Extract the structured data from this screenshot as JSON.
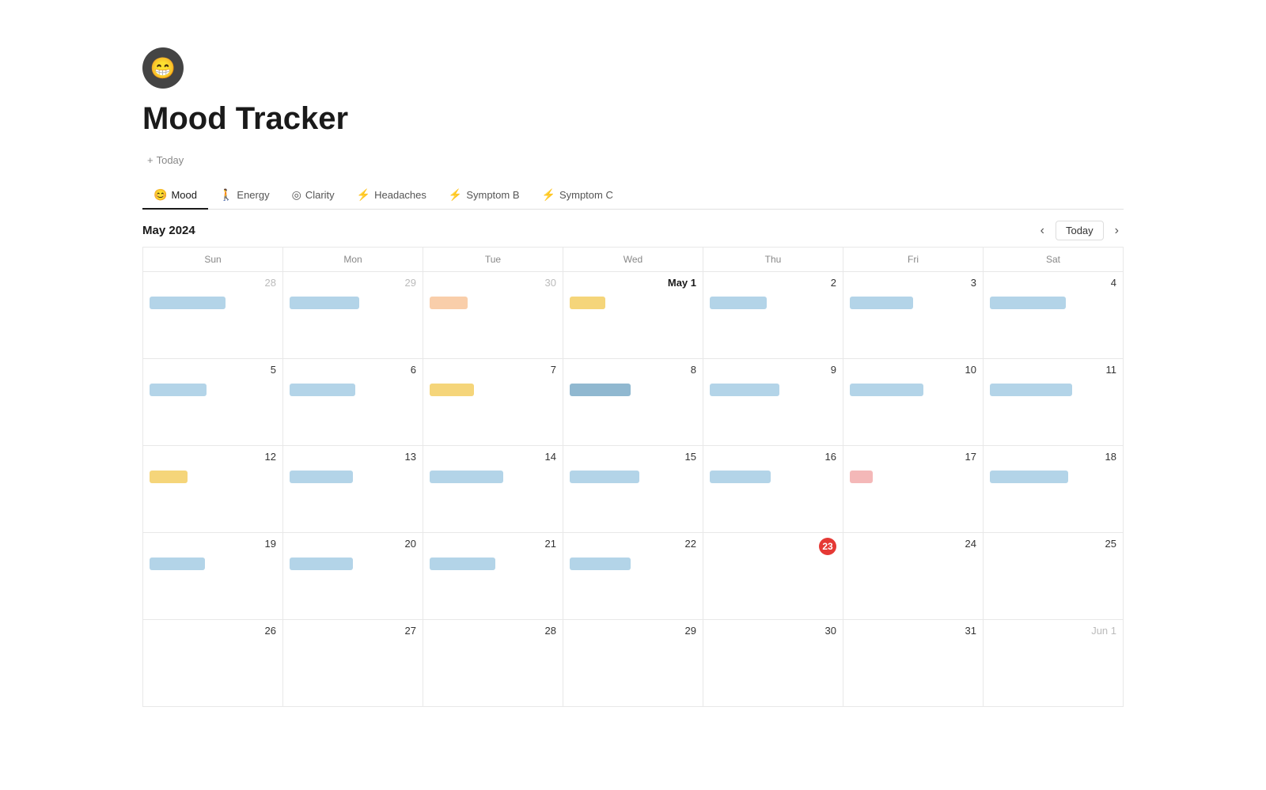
{
  "page": {
    "icon": "😁",
    "title": "Mood Tracker",
    "add_label": "+ Today"
  },
  "tabs": [
    {
      "id": "mood",
      "label": "Mood",
      "icon": "😊",
      "active": true
    },
    {
      "id": "energy",
      "label": "Energy",
      "icon": "🚶",
      "active": false
    },
    {
      "id": "clarity",
      "label": "Clarity",
      "icon": "◎",
      "active": false
    },
    {
      "id": "headaches",
      "label": "Headaches",
      "icon": "⚡",
      "active": false
    },
    {
      "id": "symptom-b",
      "label": "Symptom B",
      "icon": "⚡",
      "active": false
    },
    {
      "id": "symptom-c",
      "label": "Symptom C",
      "icon": "⚡",
      "active": false
    }
  ],
  "calendar": {
    "month_label": "May 2024",
    "today_btn": "Today",
    "days_of_week": [
      "Sun",
      "Mon",
      "Tue",
      "Wed",
      "Thu",
      "Fri",
      "Sat"
    ],
    "weeks": [
      {
        "days": [
          {
            "num": "28",
            "other_month": true,
            "bars": [
              {
                "color": "blue-light",
                "width": "60%"
              }
            ]
          },
          {
            "num": "29",
            "other_month": true,
            "bars": [
              {
                "color": "blue-light",
                "width": "55%"
              }
            ]
          },
          {
            "num": "30",
            "other_month": true,
            "bars": [
              {
                "color": "orange-light",
                "width": "30%"
              }
            ]
          },
          {
            "num": "May 1",
            "other_month": false,
            "bold": true,
            "bars": [
              {
                "color": "yellow-light",
                "width": "28%"
              }
            ]
          },
          {
            "num": "2",
            "other_month": false,
            "bars": [
              {
                "color": "blue-light",
                "width": "45%"
              }
            ]
          },
          {
            "num": "3",
            "other_month": false,
            "bars": [
              {
                "color": "blue-light",
                "width": "50%"
              }
            ]
          },
          {
            "num": "4",
            "other_month": false,
            "bars": [
              {
                "color": "blue-light",
                "width": "60%"
              }
            ]
          }
        ]
      },
      {
        "days": [
          {
            "num": "5",
            "other_month": false,
            "bars": [
              {
                "color": "blue-light",
                "width": "45%"
              }
            ]
          },
          {
            "num": "6",
            "other_month": false,
            "bars": [
              {
                "color": "blue-light",
                "width": "52%"
              }
            ]
          },
          {
            "num": "7",
            "other_month": false,
            "bars": [
              {
                "color": "yellow-light",
                "width": "35%"
              }
            ]
          },
          {
            "num": "8",
            "other_month": false,
            "bars": [
              {
                "color": "blue-med",
                "width": "48%"
              }
            ]
          },
          {
            "num": "9",
            "other_month": false,
            "bars": [
              {
                "color": "blue-light",
                "width": "55%"
              }
            ]
          },
          {
            "num": "10",
            "other_month": false,
            "bars": [
              {
                "color": "blue-light",
                "width": "58%"
              }
            ]
          },
          {
            "num": "11",
            "other_month": false,
            "bars": [
              {
                "color": "blue-light",
                "width": "65%"
              }
            ]
          }
        ]
      },
      {
        "days": [
          {
            "num": "12",
            "other_month": false,
            "bars": [
              {
                "color": "yellow-light",
                "width": "30%"
              }
            ]
          },
          {
            "num": "13",
            "other_month": false,
            "bars": [
              {
                "color": "blue-light",
                "width": "50%"
              }
            ]
          },
          {
            "num": "14",
            "other_month": false,
            "bars": [
              {
                "color": "blue-light",
                "width": "58%"
              }
            ]
          },
          {
            "num": "15",
            "other_month": false,
            "bars": [
              {
                "color": "blue-light",
                "width": "55%"
              }
            ]
          },
          {
            "num": "16",
            "other_month": false,
            "bars": [
              {
                "color": "blue-light",
                "width": "48%"
              }
            ]
          },
          {
            "num": "17",
            "other_month": false,
            "bars": [
              {
                "color": "pink-light",
                "width": "18%"
              }
            ]
          },
          {
            "num": "18",
            "other_month": false,
            "bars": [
              {
                "color": "blue-light",
                "width": "62%"
              }
            ]
          }
        ]
      },
      {
        "days": [
          {
            "num": "19",
            "other_month": false,
            "bars": [
              {
                "color": "blue-light",
                "width": "44%"
              }
            ]
          },
          {
            "num": "20",
            "other_month": false,
            "bars": [
              {
                "color": "blue-light",
                "width": "50%"
              }
            ]
          },
          {
            "num": "21",
            "other_month": false,
            "bars": [
              {
                "color": "blue-light",
                "width": "52%"
              }
            ]
          },
          {
            "num": "22",
            "other_month": false,
            "bars": [
              {
                "color": "blue-light",
                "width": "48%"
              }
            ]
          },
          {
            "num": "23",
            "other_month": false,
            "today": true,
            "bars": []
          },
          {
            "num": "24",
            "other_month": false,
            "bars": []
          },
          {
            "num": "25",
            "other_month": false,
            "bars": []
          }
        ]
      },
      {
        "days": [
          {
            "num": "26",
            "other_month": false,
            "bars": []
          },
          {
            "num": "27",
            "other_month": false,
            "bars": []
          },
          {
            "num": "28",
            "other_month": false,
            "bars": []
          },
          {
            "num": "29",
            "other_month": false,
            "bars": []
          },
          {
            "num": "30",
            "other_month": false,
            "bars": []
          },
          {
            "num": "31",
            "other_month": false,
            "bars": []
          },
          {
            "num": "Jun 1",
            "other_month": true,
            "bars": []
          }
        ]
      }
    ]
  }
}
